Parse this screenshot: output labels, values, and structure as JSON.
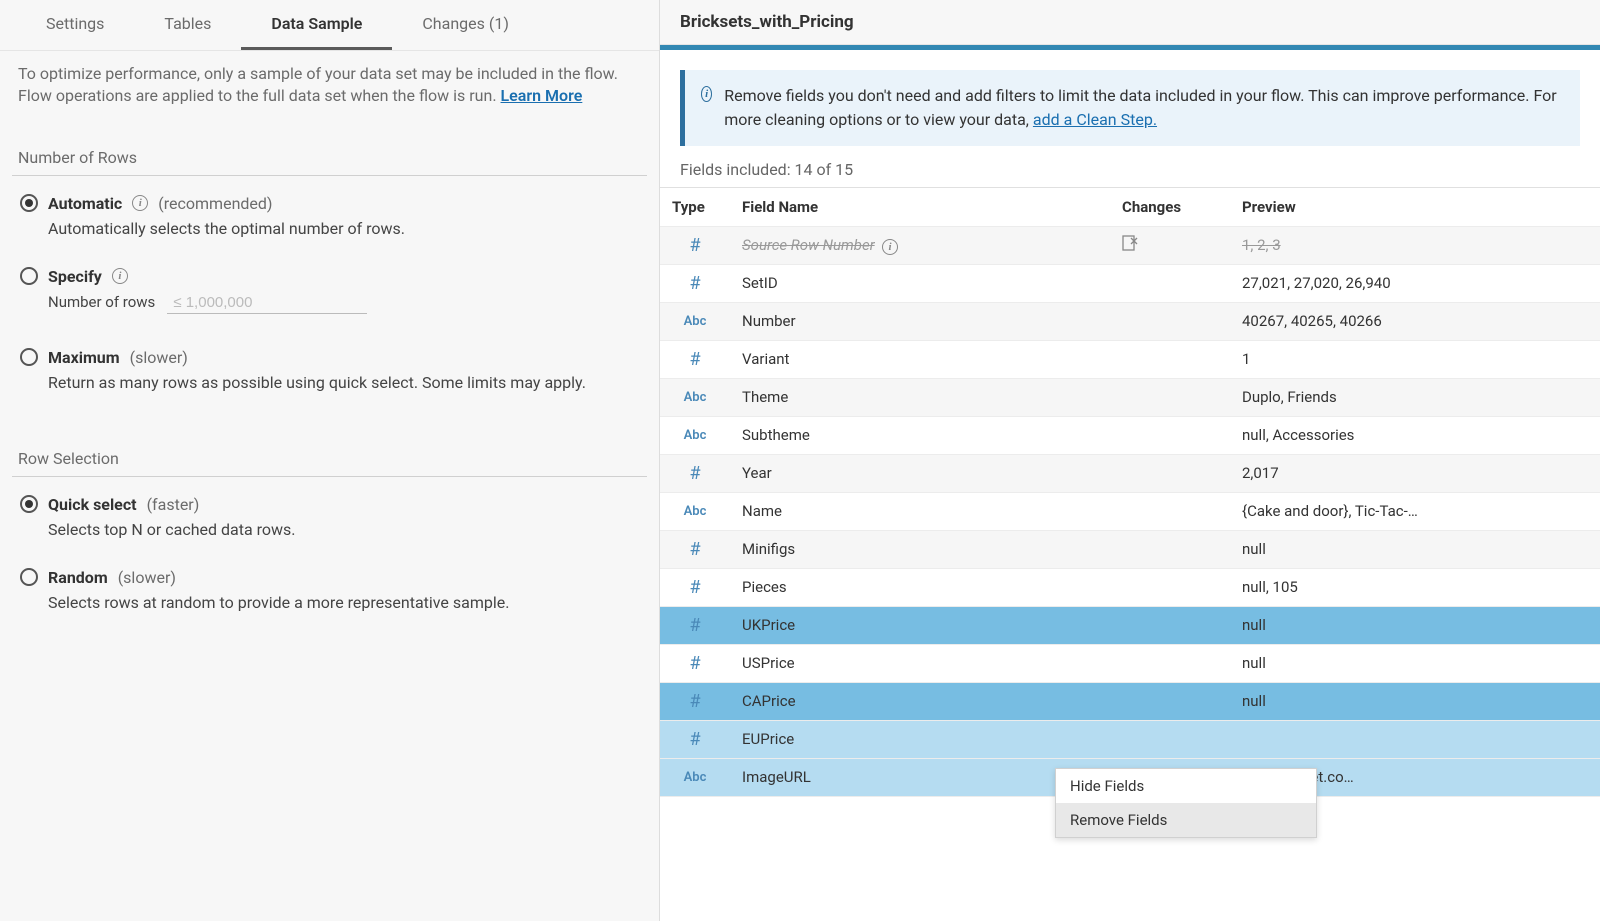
{
  "tabs": {
    "settings": "Settings",
    "tables": "Tables",
    "data_sample": "Data Sample",
    "changes": "Changes (1)"
  },
  "note_line1": "To optimize performance, only a sample of your data set may be included in the flow.",
  "note_line2_pre": "Flow operations are applied to the full data set when the flow is run. ",
  "note_learn_more": "Learn More",
  "section_num_rows": "Number of Rows",
  "num_rows": {
    "automatic_label": "Automatic",
    "automatic_hint": "(recommended)",
    "automatic_desc": "Automatically selects the optimal number of rows.",
    "specify_label": "Specify",
    "specify_rows_label": "Number of rows",
    "specify_placeholder": "≤ 1,000,000",
    "maximum_label": "Maximum",
    "maximum_hint": "(slower)",
    "maximum_desc": "Return as many rows as possible using quick select. Some limits may apply."
  },
  "section_row_selection": "Row Selection",
  "row_sel": {
    "quick_label": "Quick select",
    "quick_hint": "(faster)",
    "quick_desc": "Selects top N or cached data rows.",
    "random_label": "Random",
    "random_hint": "(slower)",
    "random_desc": "Selects rows at random to provide a more representative sample."
  },
  "dataset_title": "Bricksets_with_Pricing",
  "banner_text": "Remove fields you don't need and add filters to limit the data included in your flow. This can improve performance. For more cleaning options or to view your data, ",
  "banner_link": "add a Clean Step.",
  "fields_included": "Fields included: 14 of 15",
  "thead": {
    "type": "Type",
    "name": "Field Name",
    "changes": "Changes",
    "preview": "Preview"
  },
  "fields": [
    {
      "type": "#",
      "name": "Source Row Number",
      "preview": "1, 2, 3",
      "removed": true,
      "changesIcon": true
    },
    {
      "type": "#",
      "name": "SetID",
      "preview": "27,021, 27,020, 26,940"
    },
    {
      "type": "Abc",
      "name": "Number",
      "preview": "40267, 40265, 40266"
    },
    {
      "type": "#",
      "name": "Variant",
      "preview": "1"
    },
    {
      "type": "Abc",
      "name": "Theme",
      "preview": "Duplo, Friends"
    },
    {
      "type": "Abc",
      "name": "Subtheme",
      "preview": "null, Accessories"
    },
    {
      "type": "#",
      "name": "Year",
      "preview": "2,017"
    },
    {
      "type": "Abc",
      "name": "Name",
      "preview": "{Cake and door}, Tic-Tac-…"
    },
    {
      "type": "#",
      "name": "Minifigs",
      "preview": "null"
    },
    {
      "type": "#",
      "name": "Pieces",
      "preview": "null, 105"
    },
    {
      "type": "#",
      "name": "UKPrice",
      "preview": "null",
      "selected": "dark"
    },
    {
      "type": "#",
      "name": "USPrice",
      "preview": "null"
    },
    {
      "type": "#",
      "name": "CAPrice",
      "preview": "null",
      "selected": "dark"
    },
    {
      "type": "#",
      "name": "EUPrice",
      "preview": "",
      "selected": "light"
    },
    {
      "type": "Abc",
      "name": "ImageURL",
      "preview": "ges.brickset.co…",
      "selected": "light"
    }
  ],
  "context_menu": {
    "hide": "Hide Fields",
    "remove": "Remove Fields"
  }
}
